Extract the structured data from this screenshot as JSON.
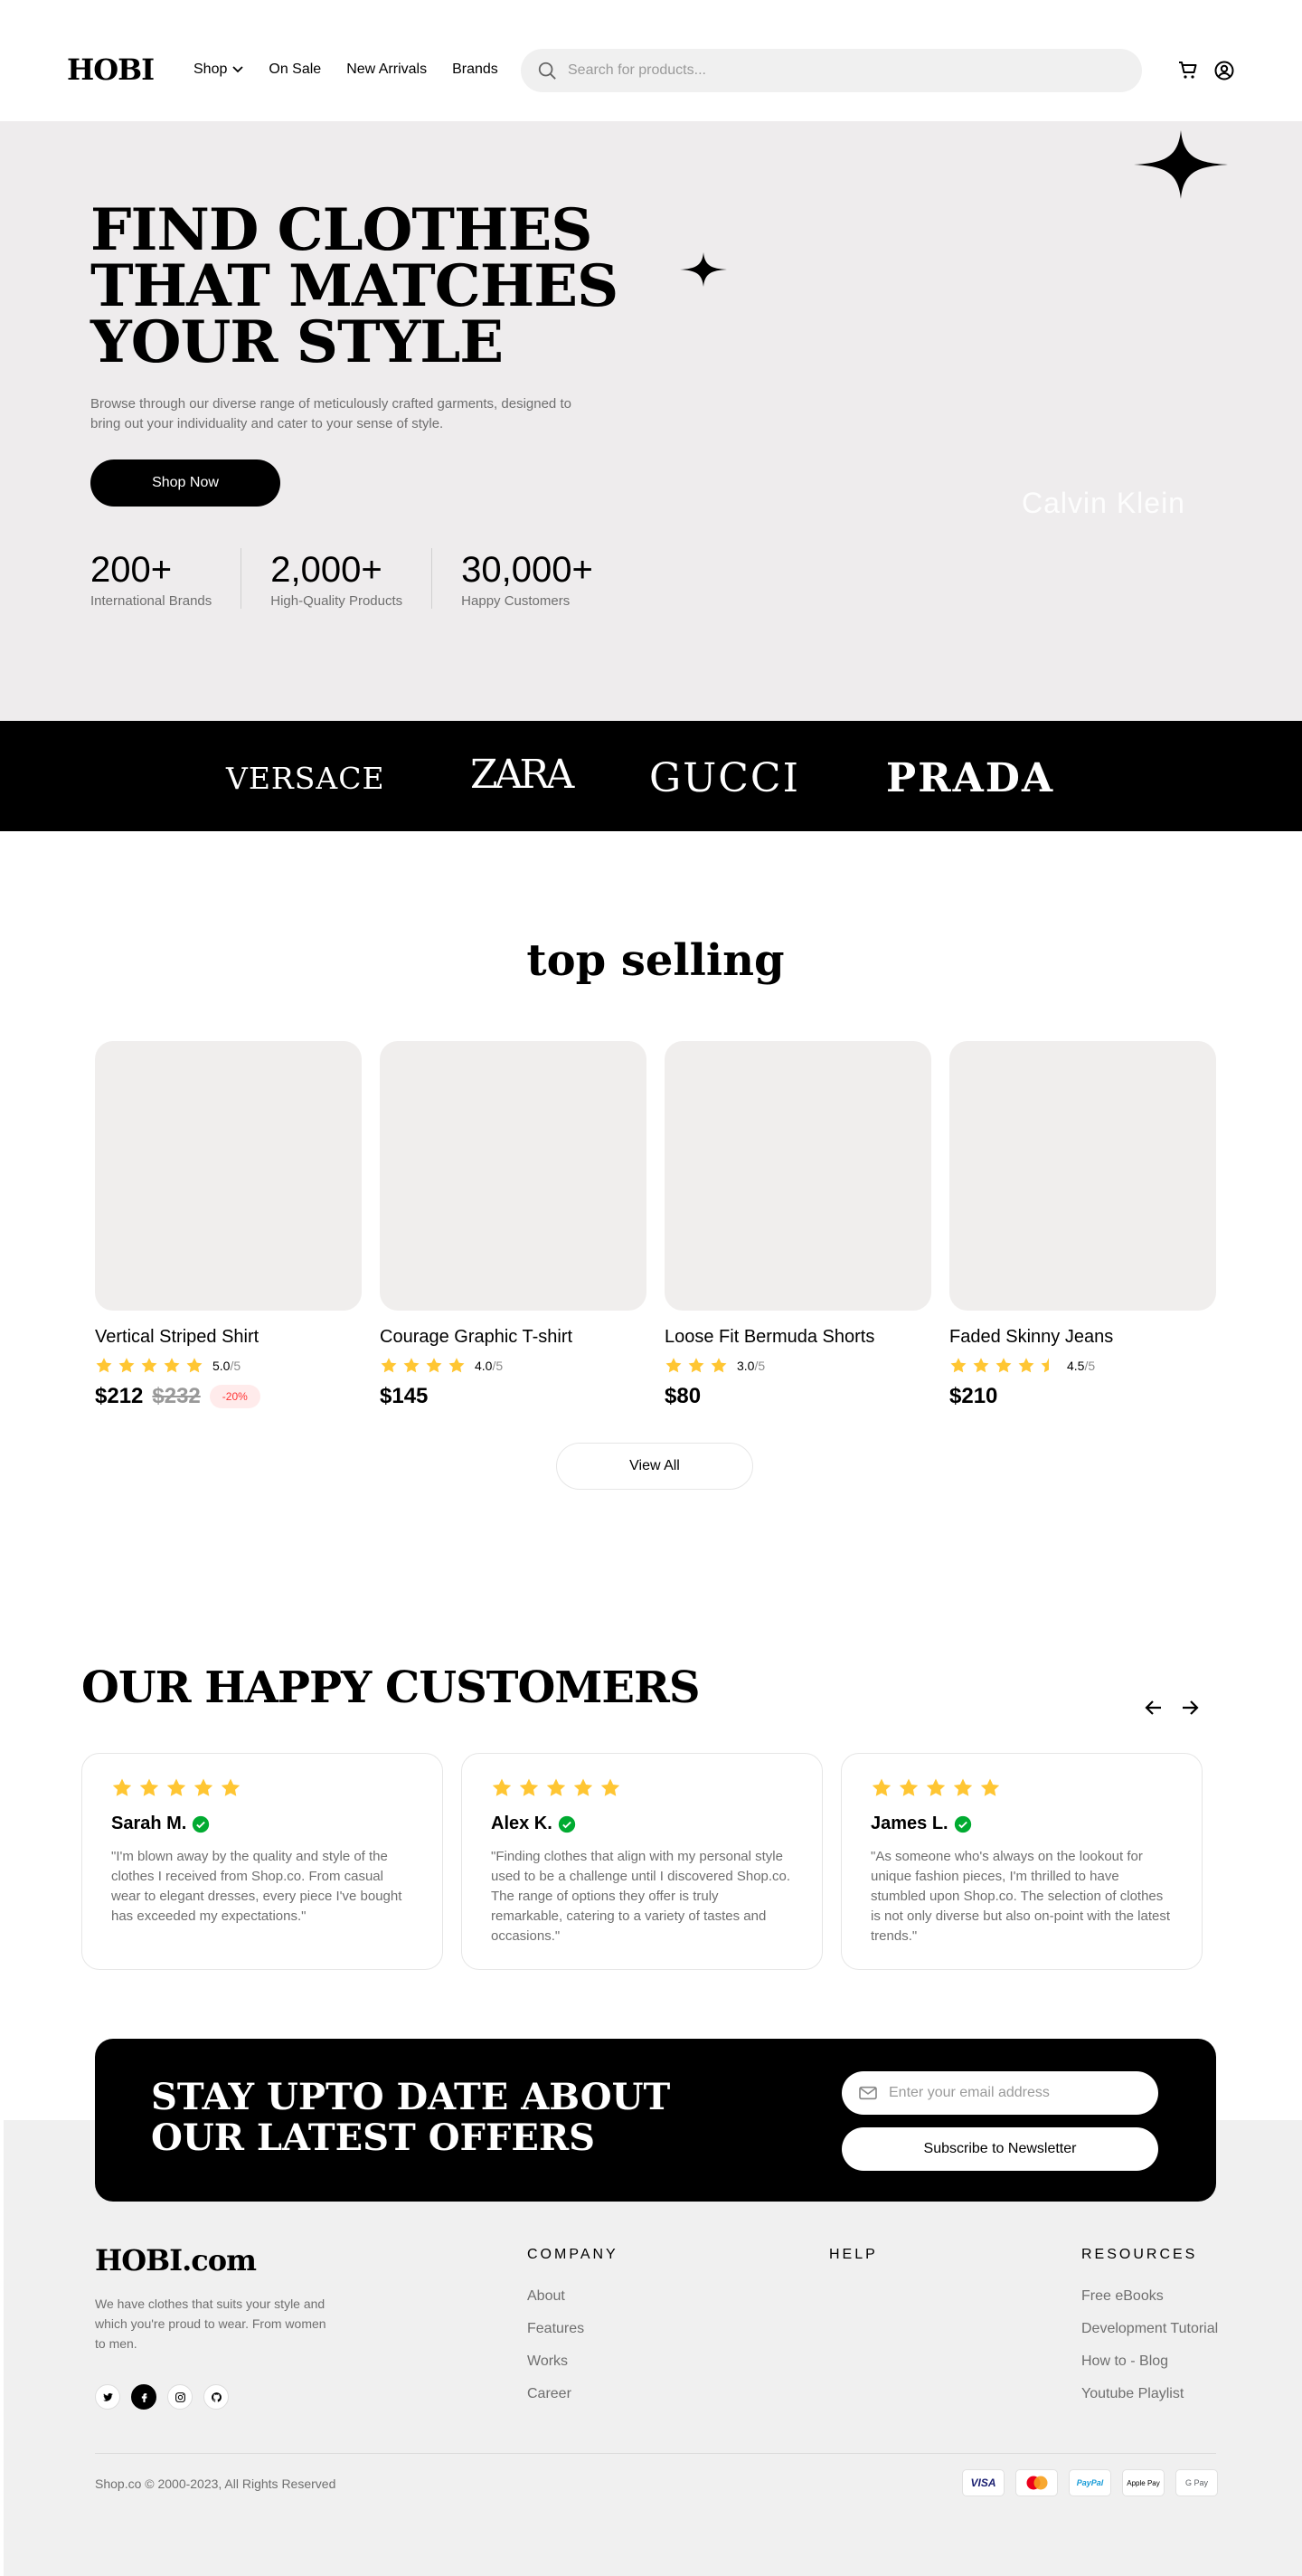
{
  "nav": {
    "logo": "HOBI",
    "links": [
      "Shop",
      "On Sale",
      "New Arrivals",
      "Brands"
    ],
    "search_placeholder": "Search for products..."
  },
  "hero": {
    "title_lines": [
      "FIND CLOTHES",
      "THAT MATCHES",
      "YOUR STYLE"
    ],
    "description": "Browse through our diverse range of meticulously crafted garments, designed to bring out your individuality and cater to your sense of style.",
    "cta": "Shop Now",
    "stats": [
      {
        "value": "200+",
        "label": "International Brands"
      },
      {
        "value": "2,000+",
        "label": "High-Quality Products"
      },
      {
        "value": "30,000+",
        "label": "Happy Customers"
      }
    ],
    "watermark": "Calvin Klein"
  },
  "brands": [
    "VERSACE",
    "ZARA",
    "GUCCI",
    "PRADA"
  ],
  "top_selling": {
    "title": "top selling",
    "products": [
      {
        "name": "Vertical Striped Shirt",
        "rating": "5.0",
        "rating_of": "/5",
        "stars": 5,
        "price": "$212",
        "old_price": "$232",
        "discount": "-20%"
      },
      {
        "name": "Courage Graphic T-shirt",
        "rating": "4.0",
        "rating_of": "/5",
        "stars": 4,
        "price": "$145"
      },
      {
        "name": "Loose Fit Bermuda Shorts",
        "rating": "3.0",
        "rating_of": "/5",
        "stars": 3,
        "price": "$80"
      },
      {
        "name": "Faded Skinny Jeans",
        "rating": "4.5",
        "rating_of": "/5",
        "stars": 4.5,
        "price": "$210"
      }
    ],
    "view_all": "View All"
  },
  "customers": {
    "title": "OUR HAPPY CUSTOMERS",
    "reviews": [
      {
        "name": "Sarah M.",
        "stars": 5,
        "text": "\"I'm blown away by the quality and style of the clothes I received from Shop.co. From casual wear to elegant dresses, every piece I've bought has exceeded my expectations.\""
      },
      {
        "name": "Alex K.",
        "stars": 5,
        "text": "\"Finding clothes that align with my personal style used to be a challenge until I discovered Shop.co. The range of options they offer is truly remarkable, catering to a variety of tastes and occasions.\""
      },
      {
        "name": "James L.",
        "stars": 5,
        "text": "\"As someone who's always on the lookout for unique fashion pieces, I'm thrilled to have stumbled upon Shop.co. The selection of clothes is not only diverse but also on-point with the latest trends.\""
      }
    ]
  },
  "newsletter": {
    "title_lines": [
      "STAY UPTO DATE ABOUT",
      "OUR LATEST OFFERS"
    ],
    "email_placeholder": "Enter your email address",
    "button": "Subscribe to Newsletter"
  },
  "footer": {
    "logo": "HOBI.com",
    "description": "We have clothes that suits your style and which you're proud to wear. From women to men.",
    "columns": [
      {
        "title": "COMPANY",
        "links": [
          "About",
          "Features",
          "Works",
          "Career"
        ]
      },
      {
        "title": "HELP",
        "links": []
      },
      {
        "title": "RESOURCES",
        "links": [
          "Free eBooks",
          "Development Tutorial",
          "How to - Blog",
          "Youtube Playlist"
        ]
      }
    ],
    "copyright": "Shop.co © 2000-2023, All Rights Reserved",
    "payments": [
      "VISA",
      "Mastercard",
      "PayPal",
      "Apple Pay",
      "G Pay"
    ]
  },
  "colors": {
    "star": "#FFC633",
    "verified": "#01AB31",
    "hero_bg": "#EEECED",
    "discount_text": "#FF3333"
  }
}
